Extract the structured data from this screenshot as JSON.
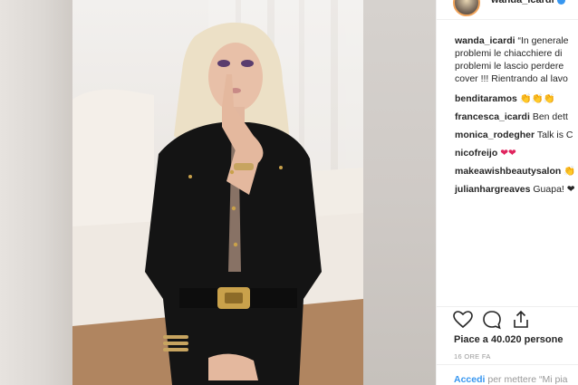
{
  "post": {
    "username": "wanda_icardi",
    "caption_lines": [
      "“In generale",
      "problemi le chiacchiere di",
      "problemi le lascio perdere",
      "cover !!! Rientrando al lavo"
    ]
  },
  "comments": [
    {
      "user": "benditaramos",
      "text": "👏👏👏"
    },
    {
      "user": "francesca_icardi",
      "text": "Ben dett"
    },
    {
      "user": "monica_rodegher",
      "text": "Talk is C"
    },
    {
      "user": "nicofreijo",
      "text": "❤❤"
    },
    {
      "user": "makeawishbeautysalon",
      "text": "👏"
    },
    {
      "user": "julianhargreaves",
      "text": "Guapa! ❤"
    }
  ],
  "actions": {
    "like_icon": "heart-outline",
    "comment_icon": "speech-bubble",
    "share_icon": "share-upload"
  },
  "likes_label": "Piace a 40.020 persone",
  "time_ago": "16 ORE FA",
  "login": {
    "link": "Accedi",
    "text": " per mettere “Mi pia"
  },
  "colors": {
    "link_blue": "#3897f0",
    "verified_blue": "#3897f0",
    "heart_red": "#e0245e",
    "muted_gray": "#999999"
  }
}
